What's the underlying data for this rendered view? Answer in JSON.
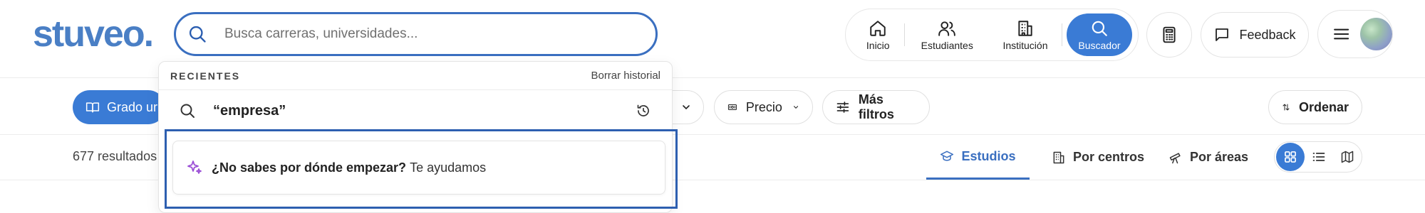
{
  "header": {
    "logo": "stuveo.",
    "search": {
      "placeholder": "Busca carreras, universidades..."
    },
    "nav": {
      "home": "Inicio",
      "students": "Estudiantes",
      "institution": "Institución",
      "search": "Buscador"
    },
    "feedback": "Feedback"
  },
  "filters": {
    "grado": "Grado ur",
    "precio": "Precio",
    "more_filters": "Más filtros",
    "ordenar": "Ordenar"
  },
  "results": {
    "count": "677 resultados",
    "tabs": {
      "estudios": "Estudios",
      "centros": "Por centros",
      "areas": "Por áreas"
    }
  },
  "dropdown": {
    "title": "RECIENTES",
    "clear": "Borrar historial",
    "recent_query": "“empresa”",
    "help_bold": "¿No sabes por dónde empezar?",
    "help_rest": "Te ayudamos"
  },
  "colors": {
    "brand": "#4a7fc5",
    "accent": "#3a7bd5",
    "focus_border": "#2d5fb0",
    "sparkle": "#9b4fd6"
  }
}
